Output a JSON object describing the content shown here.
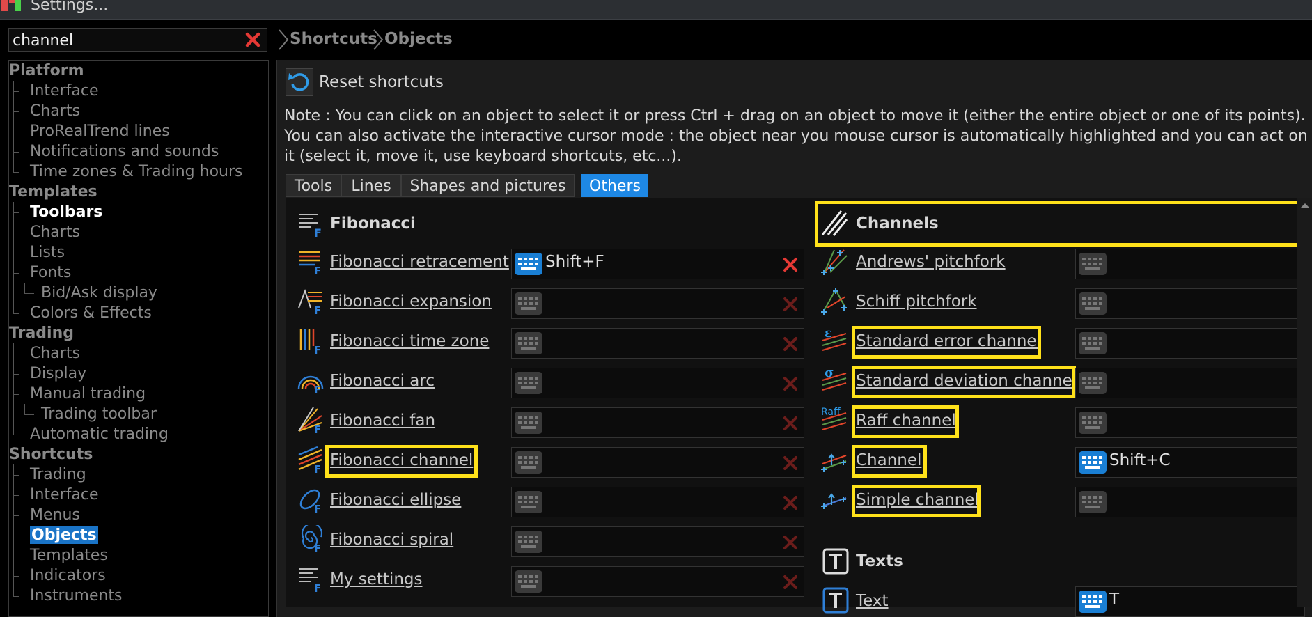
{
  "window": {
    "title": "Settings..."
  },
  "search": {
    "value": "channel",
    "placeholder": ""
  },
  "breadcrumb": [
    "Shortcuts",
    "Objects"
  ],
  "tree": [
    {
      "label": "Platform",
      "type": "cat"
    },
    {
      "label": "Interface",
      "type": "leaf"
    },
    {
      "label": "Charts",
      "type": "leaf"
    },
    {
      "label": "ProRealTrend lines",
      "type": "leaf"
    },
    {
      "label": "Notifications and sounds",
      "type": "leaf"
    },
    {
      "label": "Time zones & Trading hours",
      "type": "leaf"
    },
    {
      "label": "Templates",
      "type": "cat"
    },
    {
      "label": "Toolbars",
      "type": "active"
    },
    {
      "label": "Charts",
      "type": "leaf"
    },
    {
      "label": "Lists",
      "type": "leaf"
    },
    {
      "label": "Fonts",
      "type": "leaf"
    },
    {
      "label": "Bid/Ask display",
      "type": "sub"
    },
    {
      "label": "Colors & Effects",
      "type": "leaf"
    },
    {
      "label": "Trading",
      "type": "cat"
    },
    {
      "label": "Charts",
      "type": "leaf"
    },
    {
      "label": "Display",
      "type": "leaf"
    },
    {
      "label": "Manual trading",
      "type": "leaf"
    },
    {
      "label": "Trading toolbar",
      "type": "sub"
    },
    {
      "label": "Automatic trading",
      "type": "leaf"
    },
    {
      "label": "Shortcuts",
      "type": "cat"
    },
    {
      "label": "Trading",
      "type": "leaf"
    },
    {
      "label": "Interface",
      "type": "leaf"
    },
    {
      "label": "Menus",
      "type": "leaf"
    },
    {
      "label": "Objects",
      "type": "selected"
    },
    {
      "label": "Templates",
      "type": "leaf"
    },
    {
      "label": "Indicators",
      "type": "leaf"
    },
    {
      "label": "Instruments",
      "type": "leaf"
    }
  ],
  "reset": {
    "label": "Reset shortcuts"
  },
  "note": {
    "line1": "Note : You can click on an object to select it or press Ctrl + drag on an object to move it (either the entire object or one of its points).",
    "line2": "You can also activate the interactive cursor mode : the object near you mouse cursor is automatically highlighted and you can act on",
    "line3": "it (select it, move it, use keyboard shortcuts, etc...)."
  },
  "tabs": [
    {
      "label": "Tools",
      "active": false
    },
    {
      "label": "Lines",
      "active": false
    },
    {
      "label": "Shapes and pictures",
      "active": false
    },
    {
      "label": "Others",
      "active": true
    }
  ],
  "fibonacci": {
    "title": "Fibonacci",
    "items": [
      {
        "label": "Fibonacci retracement",
        "shortcut": "Shift+F",
        "assigned": true,
        "highlighted": false
      },
      {
        "label": "Fibonacci expansion",
        "shortcut": "",
        "assigned": false,
        "highlighted": false
      },
      {
        "label": "Fibonacci time zone",
        "shortcut": "",
        "assigned": false,
        "highlighted": false
      },
      {
        "label": "Fibonacci arc",
        "shortcut": "",
        "assigned": false,
        "highlighted": false
      },
      {
        "label": "Fibonacci fan",
        "shortcut": "",
        "assigned": false,
        "highlighted": false
      },
      {
        "label": "Fibonacci channel",
        "shortcut": "",
        "assigned": false,
        "highlighted": true
      },
      {
        "label": "Fibonacci ellipse",
        "shortcut": "",
        "assigned": false,
        "highlighted": false
      },
      {
        "label": "Fibonacci spiral",
        "shortcut": "",
        "assigned": false,
        "highlighted": false
      },
      {
        "label": "My settings",
        "shortcut": "",
        "assigned": false,
        "highlighted": false
      }
    ]
  },
  "channels": {
    "title": "Channels",
    "items": [
      {
        "label": "Andrews' pitchfork",
        "shortcut": "",
        "assigned": false,
        "highlighted": false,
        "icon_text": ""
      },
      {
        "label": "Schiff pitchfork",
        "shortcut": "",
        "assigned": false,
        "highlighted": false,
        "icon_text": ""
      },
      {
        "label": "Standard error channel",
        "shortcut": "",
        "assigned": false,
        "highlighted": true,
        "icon_text": "ε"
      },
      {
        "label": "Standard deviation channel",
        "shortcut": "",
        "assigned": false,
        "highlighted": true,
        "icon_text": "σ"
      },
      {
        "label": "Raff channel",
        "shortcut": "",
        "assigned": false,
        "highlighted": true,
        "icon_text": "Raff"
      },
      {
        "label": "Channel",
        "shortcut": "Shift+C",
        "assigned": true,
        "highlighted": true,
        "icon_text": ""
      },
      {
        "label": "Simple channel",
        "shortcut": "",
        "assigned": false,
        "highlighted": true,
        "icon_text": ""
      }
    ]
  },
  "texts": {
    "title": "Texts",
    "items": [
      {
        "label": "Text",
        "shortcut": "T",
        "assigned": true
      }
    ]
  },
  "colors": {
    "accent": "#1e88e5",
    "highlight": "#ffe11a",
    "delete": "#e53935",
    "fib_gold": "#f0b429",
    "fib_blue": "#2f7fd6",
    "fib_red": "#e0452a"
  }
}
